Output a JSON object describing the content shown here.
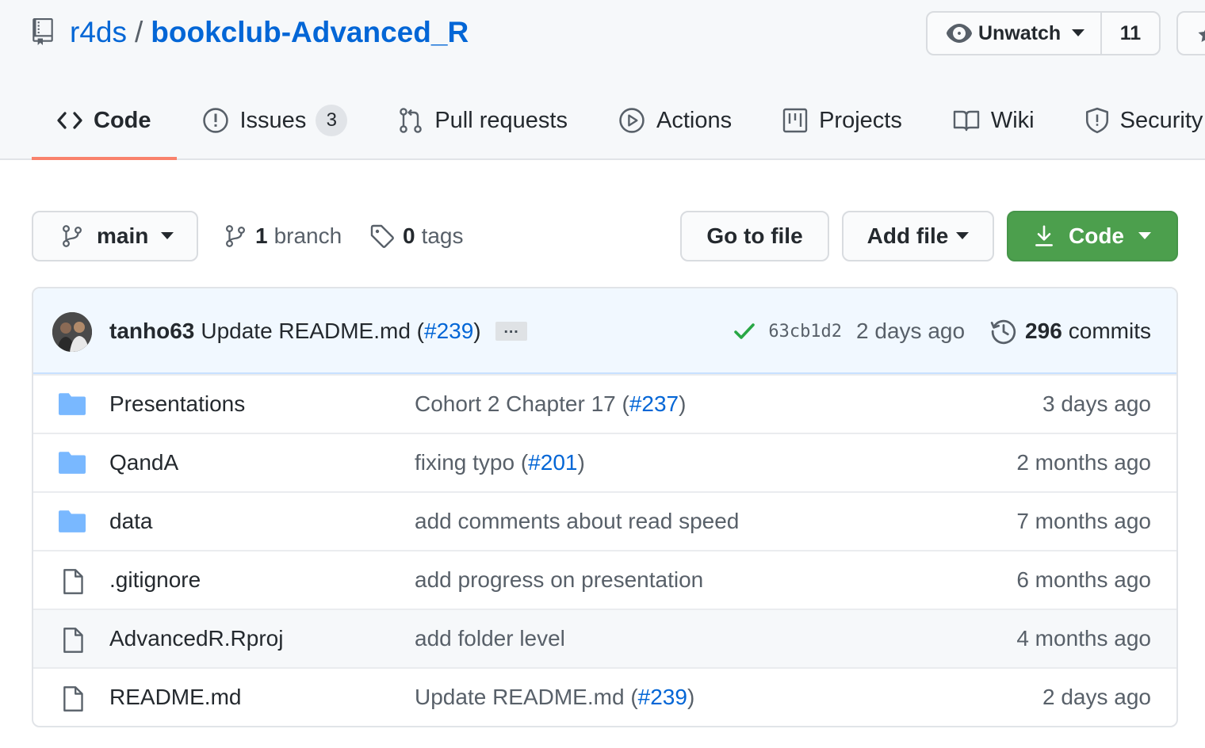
{
  "repo": {
    "owner": "r4ds",
    "separator": "/",
    "name": "bookclub-Advanced_R"
  },
  "watch": {
    "label": "Unwatch",
    "count": "11"
  },
  "tabs": [
    {
      "label": "Code",
      "icon": "code-icon",
      "selected": true
    },
    {
      "label": "Issues",
      "icon": "issue-icon",
      "counter": "3"
    },
    {
      "label": "Pull requests",
      "icon": "pull-request-icon"
    },
    {
      "label": "Actions",
      "icon": "play-icon"
    },
    {
      "label": "Projects",
      "icon": "project-icon"
    },
    {
      "label": "Wiki",
      "icon": "book-icon"
    },
    {
      "label": "Security",
      "icon": "shield-icon"
    }
  ],
  "toolbar": {
    "branch": "main",
    "branch_count": "1",
    "branch_word": "branch",
    "tag_count": "0",
    "tag_word": "tags",
    "goto_label": "Go to file",
    "addfile_label": "Add file",
    "code_label": "Code"
  },
  "latest_commit": {
    "author": "tanho63",
    "message": "Update README.md (",
    "pr": "#239",
    "message_end": ")",
    "ellipsis": "…",
    "sha": "63cb1d2",
    "age": "2 days ago",
    "commit_count": "296",
    "commit_word": "commits"
  },
  "files": [
    {
      "type": "folder",
      "name": "Presentations",
      "message": "Cohort 2 Chapter 17 (",
      "pr": "#237",
      "message_end": ")",
      "age": "3 days ago"
    },
    {
      "type": "folder",
      "name": "QandA",
      "message": "fixing typo (",
      "pr": "#201",
      "message_end": ")",
      "age": "2 months ago"
    },
    {
      "type": "folder",
      "name": "data",
      "message": "add comments about read speed",
      "pr": "",
      "message_end": "",
      "age": "7 months ago"
    },
    {
      "type": "file",
      "name": ".gitignore",
      "message": "add progress on presentation",
      "pr": "",
      "message_end": "",
      "age": "6 months ago"
    },
    {
      "type": "file",
      "name": "AdvancedR.Rproj",
      "message": "add folder level",
      "pr": "",
      "message_end": "",
      "age": "4 months ago"
    },
    {
      "type": "file",
      "name": "README.md",
      "message": "Update README.md (",
      "pr": "#239",
      "message_end": ")",
      "age": "2 days ago"
    }
  ],
  "colors": {
    "link": "#0366d6",
    "tab_underline": "#f9826c",
    "code_button": "#4c9f4d",
    "folder": "#79b8ff",
    "check": "#28a745"
  }
}
